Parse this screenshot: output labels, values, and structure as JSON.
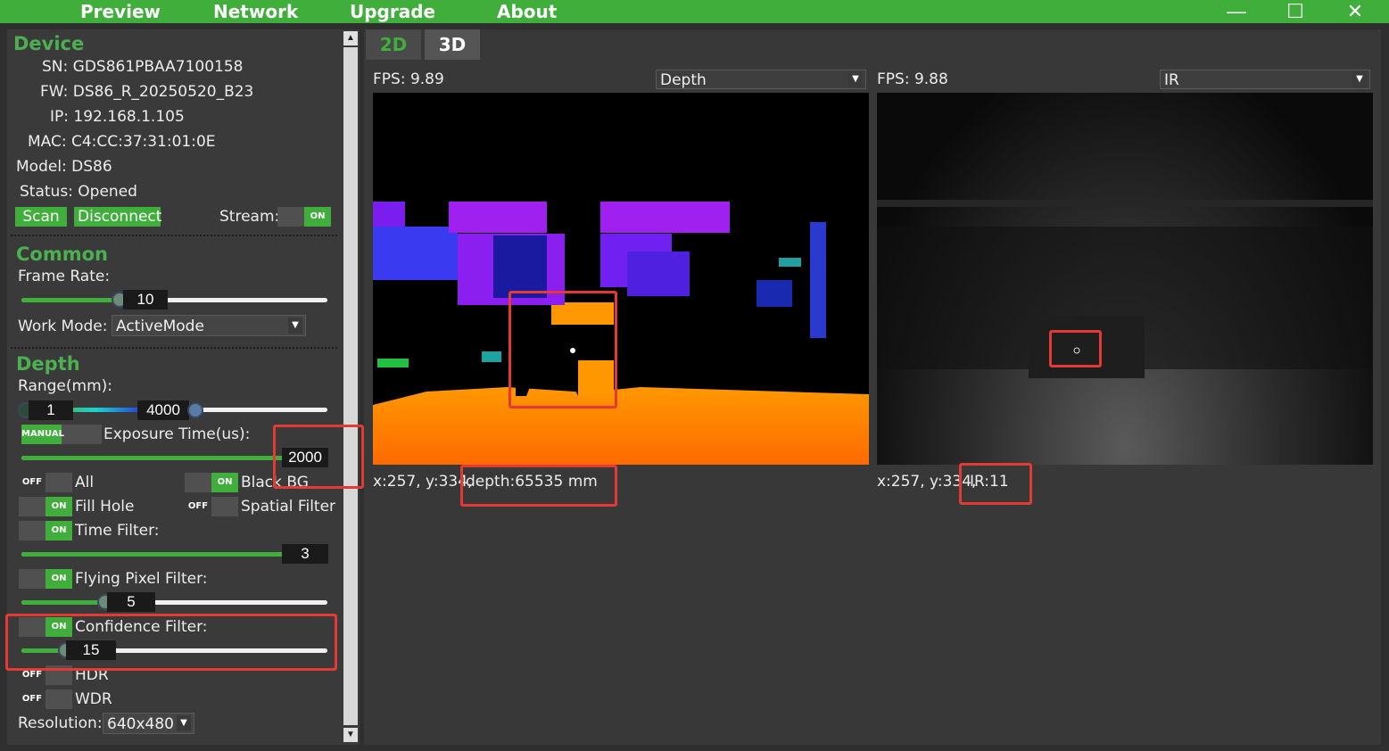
{
  "menu": {
    "preview": "Preview",
    "network": "Network",
    "upgrade": "Upgrade",
    "about": "About"
  },
  "window": {
    "minimize": "—",
    "maximize": "☐",
    "close": "✕"
  },
  "device": {
    "title": "Device",
    "sn": "SN: GDS861PBAA7100158",
    "fw": "FW: DS86_R_20250520_B23",
    "ip": "IP: 192.168.1.105",
    "mac": "MAC: C4:CC:37:31:01:0E",
    "model": "Model: DS86",
    "status": "Status: Opened",
    "scan": "Scan",
    "disconnect": "Disconnect",
    "stream_label": "Stream:",
    "stream_state": "ON"
  },
  "common": {
    "title": "Common",
    "frame_rate_label": "Frame Rate:",
    "frame_rate_value": "10",
    "frame_rate_fraction": 0.3,
    "work_mode_label": "Work Mode:",
    "work_mode_value": "ActiveMode"
  },
  "depth": {
    "title": "Depth",
    "range_label": "Range(mm):",
    "range_min": "1",
    "range_max": "4000",
    "exposure_mode": "MANUAL",
    "exposure_label": "Exposure Time(us):",
    "exposure_value": "2000",
    "toggles": {
      "all": {
        "label": "All",
        "state": "OFF"
      },
      "black_bg": {
        "label": "Black BG",
        "state": "ON"
      },
      "fill_hole": {
        "label": "Fill Hole",
        "state": "ON"
      },
      "spatial": {
        "label": "Spatial Filter",
        "state": "OFF"
      },
      "time": {
        "label": "Time Filter:",
        "state": "ON"
      },
      "flying": {
        "label": "Flying Pixel Filter:",
        "state": "ON"
      },
      "confidence": {
        "label": "Confidence Filter:",
        "state": "ON"
      },
      "hdr": {
        "label": "HDR",
        "state": "OFF"
      },
      "wdr": {
        "label": "WDR",
        "state": "OFF"
      }
    },
    "time_filter_value": "3",
    "flying_value": "5",
    "confidence_value": "15",
    "resolution_label": "Resolution:",
    "resolution_value": "640x480"
  },
  "tabs": {
    "t2d": "2D",
    "t3d": "3D"
  },
  "view_left": {
    "fps": "FPS: 9.89",
    "mode": "Depth",
    "coords": "x:257, y:334,",
    "reading": "depth:65535 mm"
  },
  "view_right": {
    "fps": "FPS: 9.88",
    "mode": "IR",
    "coords": "x:257, y:334,",
    "reading": "IR:11"
  },
  "colors": {
    "accent": "#3fae3a",
    "highlight": "#e53935"
  }
}
